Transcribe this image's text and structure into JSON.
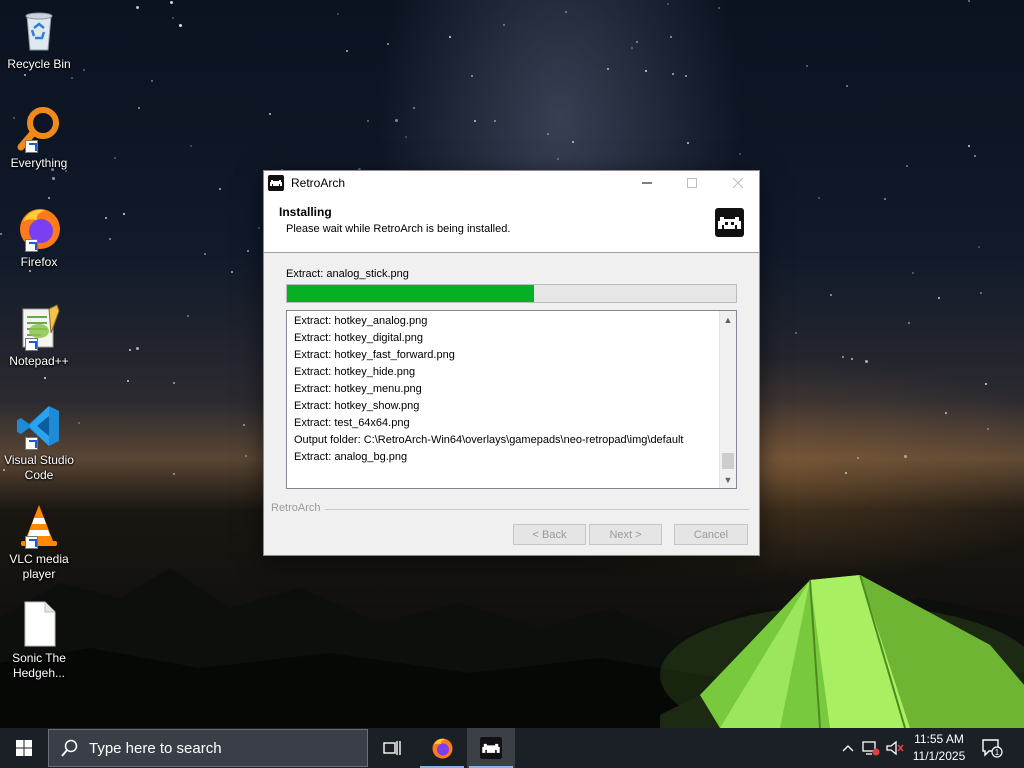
{
  "desktop": {
    "icons": [
      {
        "label": "Recycle Bin",
        "icon": "recycle-bin-icon"
      },
      {
        "label": "Everything",
        "icon": "everything-search-icon"
      },
      {
        "label": "Firefox",
        "icon": "firefox-icon"
      },
      {
        "label": "Notepad++",
        "icon": "notepad-plus-plus-icon"
      },
      {
        "label": "Visual Studio Code",
        "icon": "vscode-icon"
      },
      {
        "label": "VLC media player",
        "icon": "vlc-icon"
      },
      {
        "label": "Sonic The Hedgeh...",
        "icon": "blank-file-icon"
      }
    ]
  },
  "window": {
    "title": "RetroArch",
    "header_title": "Installing",
    "header_subtitle": "Please wait while RetroArch is being installed.",
    "status_text": "Extract: analog_stick.png",
    "progress_fraction": 0.55,
    "log_lines": [
      "Extract: hotkey_analog.png",
      "Extract: hotkey_digital.png",
      "Extract: hotkey_fast_forward.png",
      "Extract: hotkey_hide.png",
      "Extract: hotkey_menu.png",
      "Extract: hotkey_show.png",
      "Extract: test_64x64.png",
      "Output folder: C:\\RetroArch-Win64\\overlays\\gamepads\\neo-retropad\\img\\default",
      "Extract: analog_bg.png"
    ],
    "brand_label": "RetroArch",
    "buttons": {
      "back": "< Back",
      "next": "Next >",
      "cancel": "Cancel"
    }
  },
  "taskbar": {
    "search_placeholder": "Type here to search",
    "clock_time": "11:55 AM",
    "clock_date": "11/1/2025",
    "notification_count": "1"
  },
  "colors": {
    "progress_fill": "#06b025",
    "taskbar_bg": "#1b1f26",
    "tent_green": "#8de04a"
  }
}
